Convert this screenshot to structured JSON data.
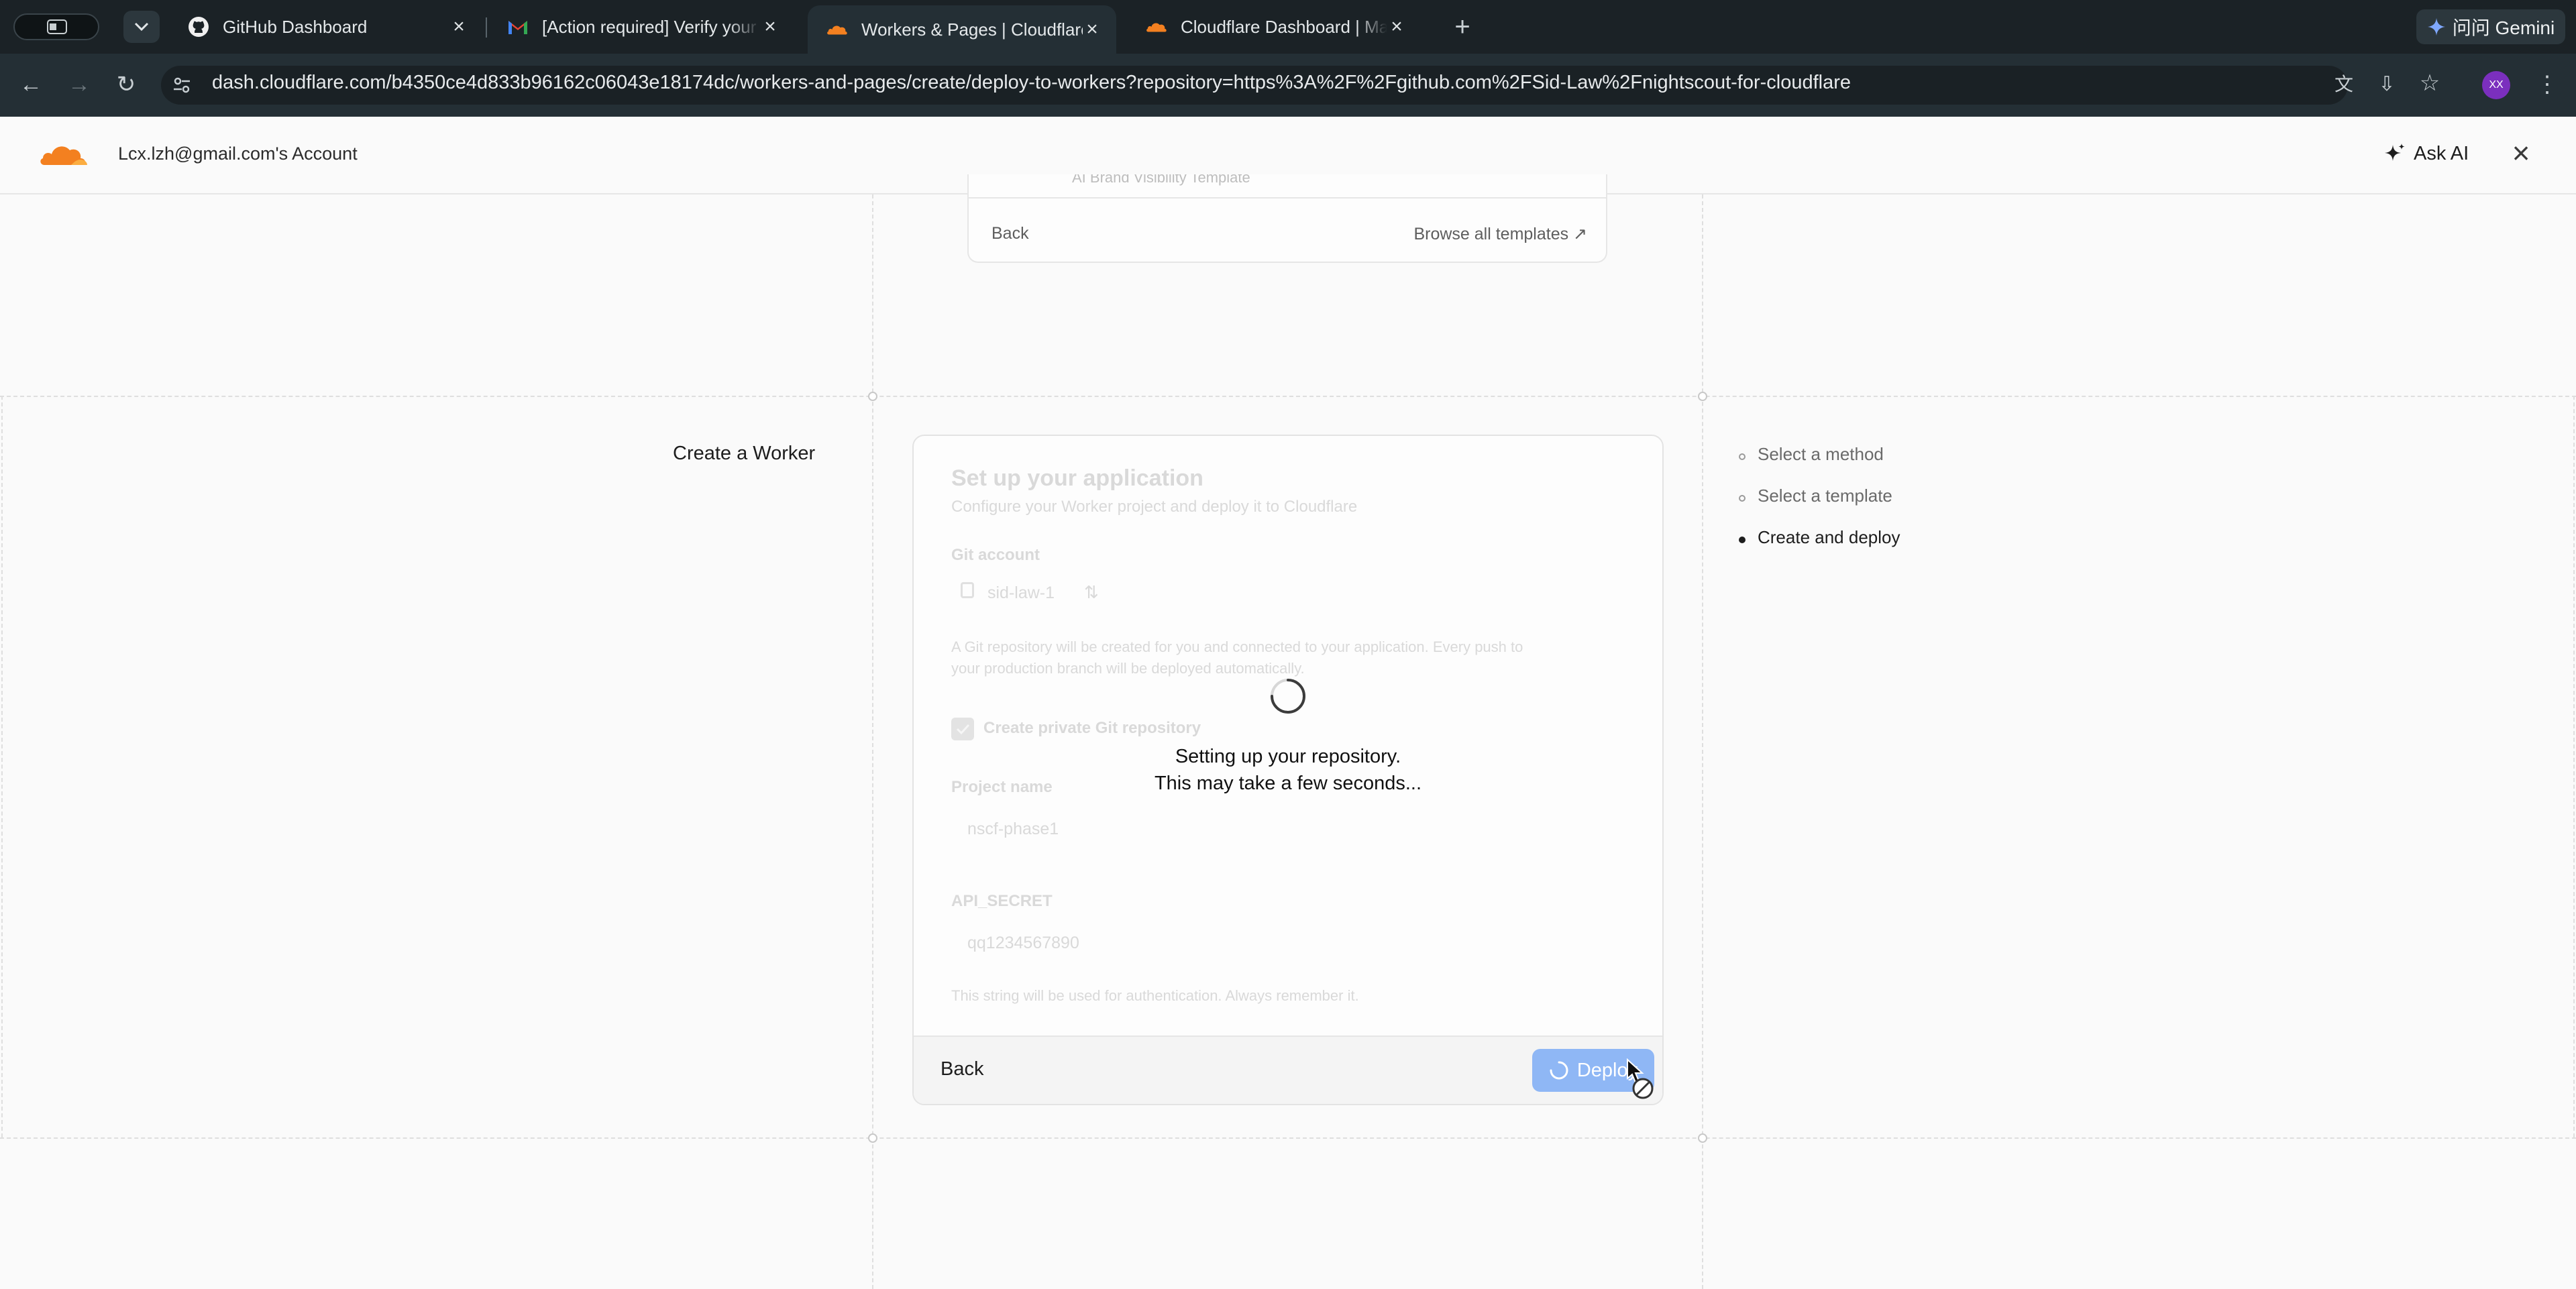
{
  "browser": {
    "tabs": [
      {
        "title": "GitHub Dashboard",
        "icon": "github-icon",
        "active": false
      },
      {
        "title": "[Action required] Verify your",
        "icon": "gmail-icon",
        "active": false
      },
      {
        "title": "Workers & Pages | Cloudflare",
        "icon": "cloudflare-icon",
        "active": true
      },
      {
        "title": "Cloudflare Dashboard | Mana",
        "icon": "cloudflare-icon",
        "active": false
      }
    ],
    "url": "dash.cloudflare.com/b4350ce4d833b96162c06043e18174dc/workers-and-pages/create/deploy-to-workers?repository=https%3A%2F%2Fgithub.com%2FSid-Law%2Fnightscout-for-cloudflare",
    "gemini_label": "问问 Gemini",
    "profile_initials": "XX"
  },
  "header": {
    "account": "Lcx.lzh@gmail.com's Account",
    "ask_ai": "Ask AI"
  },
  "template_card": {
    "item_peek": "AI Brand Visibility Template",
    "back": "Back",
    "browse": "Browse all templates ↗"
  },
  "page": {
    "title": "Create a Worker",
    "steps": [
      {
        "label": "Select a method",
        "state": "done"
      },
      {
        "label": "Select a template",
        "state": "done"
      },
      {
        "label": "Create and deploy",
        "state": "current"
      }
    ]
  },
  "form": {
    "heading": "Set up your application",
    "subheading": "Configure your Worker project and deploy it to Cloudflare",
    "git_account_label": "Git account",
    "git_account_value": "sid-law-1",
    "git_note_line1": "A Git repository will be created for you and connected to your application. Every push to",
    "git_note_line2": "your production branch will be deployed automatically.",
    "private_repo_label": "Create private Git repository",
    "project_name_label": "Project name",
    "project_name_value": "nscf-phase1",
    "api_secret_label": "API_SECRET",
    "api_secret_value": "qq1234567890",
    "api_secret_note": "This string will be used for authentication. Always remember it.",
    "loading_line1": "Setting up your repository.",
    "loading_line2": "This may take a few seconds...",
    "back": "Back",
    "deploy": "Deploy"
  },
  "colors": {
    "brand_orange": "#f38020",
    "deploy_blue": "#8fb7f5",
    "tab_bar": "#1b2226",
    "address_bar": "#242f35"
  }
}
